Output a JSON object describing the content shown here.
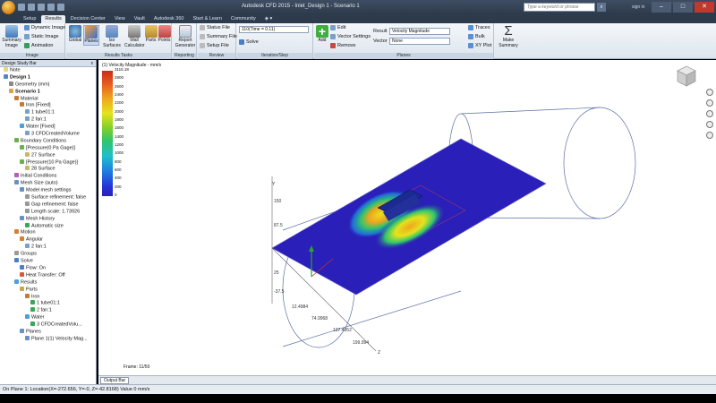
{
  "window": {
    "title": "Autodesk CFD 2015 - Inlet_Design 1 - Scenario 1",
    "search_placeholder": "Type a keyword or phrase",
    "user": "sign in"
  },
  "tabs": [
    "Setup",
    "Results",
    "Decision Center",
    "View",
    "Vault",
    "Autodesk 360",
    "Start & Learn",
    "Community",
    "◈ ▾"
  ],
  "active_tab": "Results",
  "ribbon": {
    "image_panel": {
      "title": "Image",
      "summary_image": "Summary Image",
      "dynamic_image": "Dynamic Image",
      "static_image": "Static Image",
      "animation": "Animation"
    },
    "results_tasks": {
      "title": "Results Tasks",
      "global": "Global",
      "planes": "Planes",
      "iso_surfaces": "Iso Surfaces",
      "wall_calculator": "Wall Calculator",
      "parts": "Parts",
      "points": "Points"
    },
    "reporting": {
      "title": "Reporting",
      "report_generator": "Report Generator"
    },
    "review": {
      "title": "Review",
      "status_file": "Status File",
      "summary_file": "Summary File",
      "setup_file": "Setup File"
    },
    "iteration": {
      "title": "Iteration/Step",
      "time_value": "110(Time = 0.11)",
      "solve": "Solve"
    },
    "planes": {
      "title": "Planes",
      "add": "Add",
      "edit": "Edit",
      "vector_settings": "Vector Settings",
      "remove": "Remove",
      "result_label": "Result",
      "result_value": "Velocity Magnitude",
      "vector_label": "Vector",
      "vector_value": "None",
      "traces": "Traces",
      "bulk": "Bulk",
      "xy_plot": "XY Plot"
    },
    "summary": {
      "make_summary": "Make Summary"
    }
  },
  "design_study_bar": {
    "title": "Design Study Bar",
    "close": "x",
    "tree": [
      {
        "label": "Note",
        "depth": 0,
        "icon": "note-icon",
        "color": "#e9d77a"
      },
      {
        "label": "Design 1",
        "depth": 0,
        "icon": "design-icon",
        "color": "#4f86c6",
        "bold": true
      },
      {
        "label": "Geometry (mm)",
        "depth": 1,
        "icon": "geometry-icon",
        "color": "#888888"
      },
      {
        "label": "Scenario 1",
        "depth": 1,
        "icon": "scenario-icon",
        "color": "#d4a64a",
        "bold": true
      },
      {
        "label": "Material",
        "depth": 2,
        "icon": "material-icon",
        "color": "#c27c3a"
      },
      {
        "label": "Iron [Fixed]",
        "depth": 3,
        "icon": "material-icon",
        "color": "#c27c3a"
      },
      {
        "label": "1 tube01:1",
        "depth": 4,
        "icon": "part-icon",
        "color": "#7aa0c8"
      },
      {
        "label": "2 fan:1",
        "depth": 4,
        "icon": "part-icon",
        "color": "#7aa0c8"
      },
      {
        "label": "Water [Fixed]",
        "depth": 3,
        "icon": "material-icon",
        "color": "#4aa0d8"
      },
      {
        "label": "3 CFDCreatedVolume",
        "depth": 4,
        "icon": "part-icon",
        "color": "#7aa0c8"
      },
      {
        "label": "Boundary Conditions",
        "depth": 2,
        "icon": "bc-icon",
        "color": "#6ab04c"
      },
      {
        "label": "[Pressure(0 Pa Gage)]",
        "depth": 3,
        "icon": "bc-icon",
        "color": "#6ab04c"
      },
      {
        "label": "27 Surface",
        "depth": 4,
        "icon": "surface-icon",
        "color": "#c8b86a"
      },
      {
        "label": "[Pressure(10 Pa Gage)]",
        "depth": 3,
        "icon": "bc-icon",
        "color": "#6ab04c"
      },
      {
        "label": "28 Surface",
        "depth": 4,
        "icon": "surface-icon",
        "color": "#c8b86a"
      },
      {
        "label": "Initial Conditions",
        "depth": 2,
        "icon": "ic-icon",
        "color": "#b85cb8"
      },
      {
        "label": "Mesh Size (auto)",
        "depth": 2,
        "icon": "mesh-icon",
        "color": "#6a8fc0"
      },
      {
        "label": "Model mesh settings",
        "depth": 3,
        "icon": "mesh-icon",
        "color": "#6a8fc0"
      },
      {
        "label": "Surface refinement: false",
        "depth": 4,
        "icon": "dot-icon",
        "color": "#999999"
      },
      {
        "label": "Gap refinement: false",
        "depth": 4,
        "icon": "dot-icon",
        "color": "#999999"
      },
      {
        "label": "Length scale: 1.73926",
        "depth": 4,
        "icon": "dot-icon",
        "color": "#999999"
      },
      {
        "label": "Mesh History",
        "depth": 3,
        "icon": "mesh-icon",
        "color": "#6a8fc0"
      },
      {
        "label": "Automatic size",
        "depth": 4,
        "icon": "check-icon",
        "color": "#3aa65a"
      },
      {
        "label": "Motion",
        "depth": 2,
        "icon": "motion-icon",
        "color": "#d47f30"
      },
      {
        "label": "Angular",
        "depth": 3,
        "icon": "motion-icon",
        "color": "#d47f30"
      },
      {
        "label": "2 fan:1",
        "depth": 4,
        "icon": "part-icon",
        "color": "#7aa0c8"
      },
      {
        "label": "Groups",
        "depth": 2,
        "icon": "group-icon",
        "color": "#9a9a9a"
      },
      {
        "label": "Solve",
        "depth": 2,
        "icon": "solve-icon",
        "color": "#4a7ec8"
      },
      {
        "label": "Flow: On",
        "depth": 3,
        "icon": "flow-icon",
        "color": "#4a7ec8"
      },
      {
        "label": "Heat Transfer: Off",
        "depth": 3,
        "icon": "heat-icon",
        "color": "#d25a3a"
      },
      {
        "label": "Results",
        "depth": 2,
        "icon": "results-icon",
        "color": "#4aa0d8"
      },
      {
        "label": "Parts",
        "depth": 3,
        "icon": "parts-icon",
        "color": "#c8a84a"
      },
      {
        "label": "Iron",
        "depth": 4,
        "icon": "material-icon",
        "color": "#c27c3a"
      },
      {
        "label": "1 tube01:1",
        "depth": 5,
        "icon": "check-icon",
        "color": "#3aa65a"
      },
      {
        "label": "2 fan:1",
        "depth": 5,
        "icon": "check-icon",
        "color": "#3aa65a"
      },
      {
        "label": "Water",
        "depth": 4,
        "icon": "material-icon",
        "color": "#4aa0d8"
      },
      {
        "label": "3 CFDCreatedVolu...",
        "depth": 5,
        "icon": "check-icon",
        "color": "#3aa65a"
      },
      {
        "label": "Planes",
        "depth": 3,
        "icon": "planes-icon",
        "color": "#6a8fc0"
      },
      {
        "label": "Plane 1(1) Velocity Mag...",
        "depth": 4,
        "icon": "plane-icon",
        "color": "#6a8fc0"
      }
    ]
  },
  "viewport": {
    "legend_title": "(1) Velocity Magnitude - mm/s",
    "legend_ticks": [
      "3115.18",
      "2800",
      "2600",
      "2400",
      "2200",
      "2000",
      "1800",
      "1600",
      "1400",
      "1200",
      "1000",
      "800",
      "600",
      "400",
      "200",
      "0"
    ],
    "axis_labels": [
      "150",
      "87.5",
      "25",
      "-37.5",
      "12.4984",
      "74.9968",
      "137.4952",
      "199.994"
    ],
    "axis_names": [
      "Y",
      "X",
      "Z"
    ],
    "frame_label": "Frame: 11/50"
  },
  "bottom": {
    "output_bar_tab": "Output Bar",
    "status": "On Plane 1: Location(X=-272.656, Y=-0, Z=-42.8168)  Value  0   mm/s"
  },
  "colors": {
    "title_bar": "#2f3d4f",
    "ribbon": "#e4ebf3",
    "plane_field": "#2a1fb8",
    "hot_spot": "#e4e31c"
  }
}
